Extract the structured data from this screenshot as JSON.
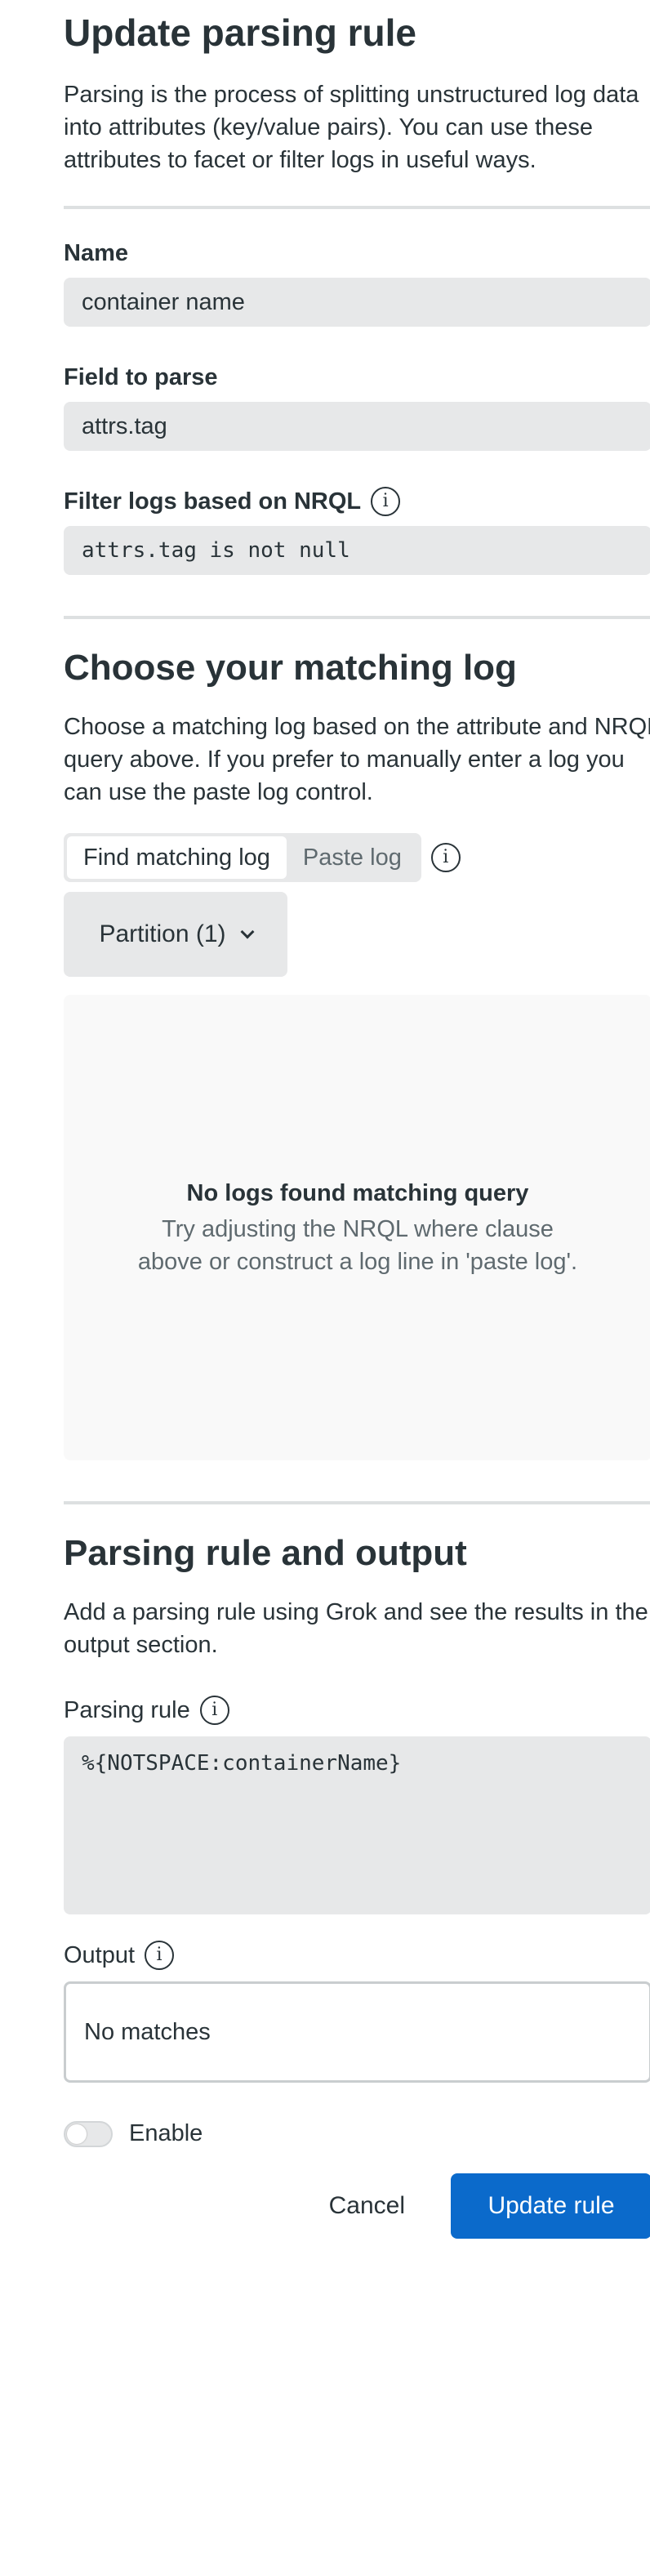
{
  "header": {
    "title": "Update parsing rule",
    "intro": "Parsing is the process of splitting unstructured log data into attributes (key/value pairs). You can use these attributes to facet or filter logs in useful ways."
  },
  "form": {
    "name_label": "Name",
    "name_value": "container name",
    "field_label": "Field to parse",
    "field_value": "attrs.tag",
    "filter_label": "Filter logs based on NRQL",
    "filter_value": "attrs.tag is not null"
  },
  "matching": {
    "title": "Choose your matching log",
    "description": "Choose a matching log based on the attribute and NRQL query above. If you prefer to manually enter a log you can use the paste log control.",
    "tabs": [
      "Find matching log",
      "Paste log"
    ],
    "active_tab": "Find matching log",
    "partition_label": "Partition (1)",
    "empty_title": "No logs found matching query",
    "empty_text": "Try adjusting the NRQL where clause above or construct a log line in 'paste log'."
  },
  "parsing": {
    "title": "Parsing rule and output",
    "description": "Add a parsing rule using Grok and see the results in the output section.",
    "rule_label": "Parsing rule",
    "rule_value": "%{NOTSPACE:containerName}",
    "output_label": "Output",
    "output_value": "No matches",
    "enable_label": "Enable",
    "enabled": false
  },
  "actions": {
    "cancel": "Cancel",
    "submit": "Update rule"
  },
  "icons": {
    "info": "info-icon",
    "chevron": "chevron-down-icon"
  },
  "colors": {
    "primary": "#0b6acb",
    "text": "#293338",
    "field_bg": "#e7e8e9"
  }
}
